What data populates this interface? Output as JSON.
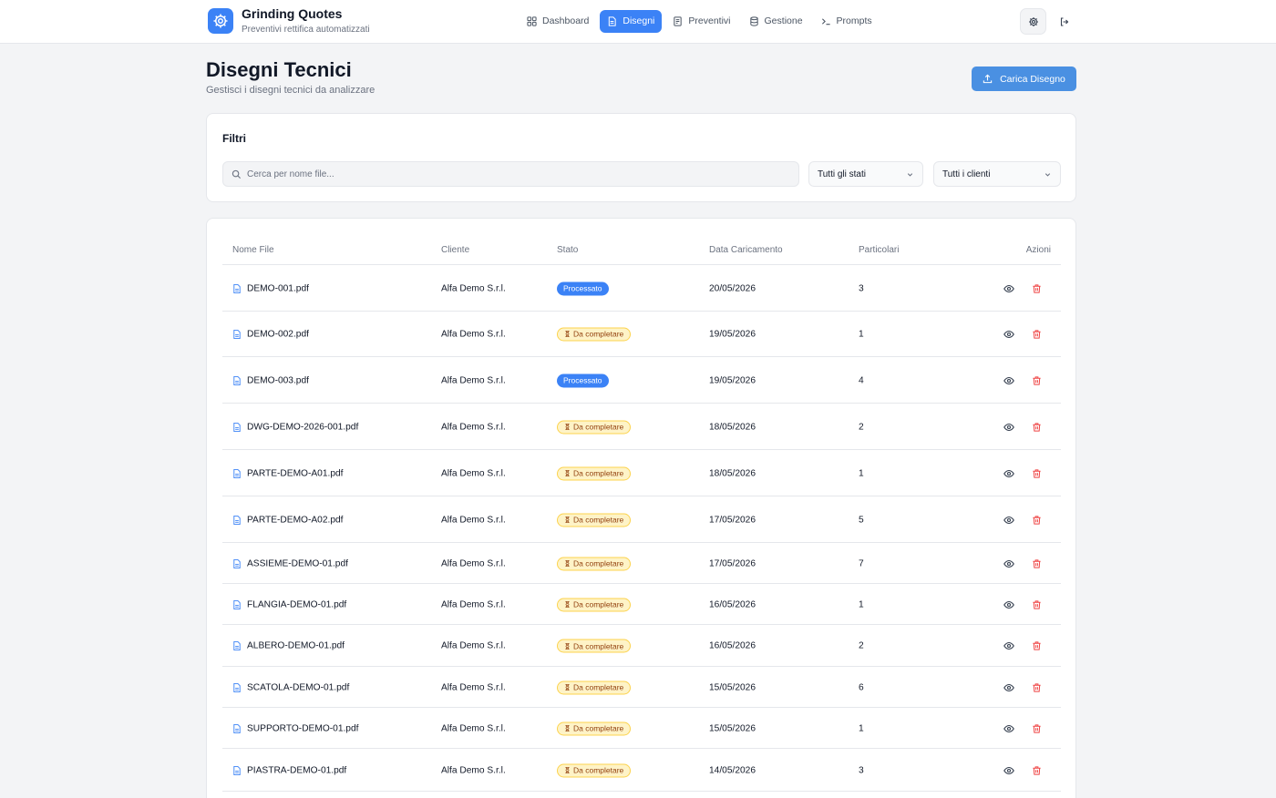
{
  "app": {
    "title": "Grinding Quotes",
    "subtitle": "Preventivi rettifica automatizzati",
    "accent": "#3b82f6"
  },
  "nav": [
    {
      "label": "Dashboard",
      "icon": "grid-icon",
      "active": false
    },
    {
      "label": "Disegni",
      "icon": "file-icon",
      "active": true
    },
    {
      "label": "Preventivi",
      "icon": "document-icon",
      "active": false
    },
    {
      "label": "Gestione",
      "icon": "database-icon",
      "active": false
    },
    {
      "label": "Prompts",
      "icon": "terminal-icon",
      "active": false
    }
  ],
  "page": {
    "title": "Disegni Tecnici",
    "subtitle": "Gestisci i disegni tecnici da analizzare",
    "upload_label": "Carica Disegno"
  },
  "filters": {
    "title": "Filtri",
    "search_placeholder": "Cerca per nome file...",
    "status_select": "Tutti gli stati",
    "client_select": "Tutti i clienti"
  },
  "table": {
    "headers": {
      "file": "Nome File",
      "client": "Cliente",
      "status": "Stato",
      "date": "Data Caricamento",
      "parts": "Particolari",
      "actions": "Azioni"
    },
    "rows": [
      {
        "file": "DEMO-001.pdf",
        "client": "Alfa Demo S.r.l.",
        "status": "Processato",
        "status_type": "processed",
        "date": "20/05/2026",
        "parts": "3"
      },
      {
        "file": "DEMO-002.pdf",
        "client": "Alfa Demo S.r.l.",
        "status": "Da completare",
        "status_type": "pending",
        "date": "19/05/2026",
        "parts": "1"
      },
      {
        "file": "DEMO-003.pdf",
        "client": "Alfa Demo S.r.l.",
        "status": "Processato",
        "status_type": "processed",
        "date": "19/05/2026",
        "parts": "4"
      },
      {
        "file": "DWG-DEMO-2026-001.pdf",
        "client": "Alfa Demo S.r.l.",
        "status": "Da completare",
        "status_type": "pending",
        "date": "18/05/2026",
        "parts": "2"
      },
      {
        "file": "PARTE-DEMO-A01.pdf",
        "client": "Alfa Demo S.r.l.",
        "status": "Da completare",
        "status_type": "pending",
        "date": "18/05/2026",
        "parts": "1"
      },
      {
        "file": "PARTE-DEMO-A02.pdf",
        "client": "Alfa Demo S.r.l.",
        "status": "Da completare",
        "status_type": "pending",
        "date": "17/05/2026",
        "parts": "5"
      },
      {
        "file": "ASSIEME-DEMO-01.pdf",
        "client": "Alfa Demo S.r.l.",
        "status": "Da completare",
        "status_type": "pending",
        "date": "17/05/2026",
        "parts": "7"
      },
      {
        "file": "FLANGIA-DEMO-01.pdf",
        "client": "Alfa Demo S.r.l.",
        "status": "Da completare",
        "status_type": "pending",
        "date": "16/05/2026",
        "parts": "1"
      },
      {
        "file": "ALBERO-DEMO-01.pdf",
        "client": "Alfa Demo S.r.l.",
        "status": "Da completare",
        "status_type": "pending",
        "date": "16/05/2026",
        "parts": "2"
      },
      {
        "file": "SCATOLA-DEMO-01.pdf",
        "client": "Alfa Demo S.r.l.",
        "status": "Da completare",
        "status_type": "pending",
        "date": "15/05/2026",
        "parts": "6"
      },
      {
        "file": "SUPPORTO-DEMO-01.pdf",
        "client": "Alfa Demo S.r.l.",
        "status": "Da completare",
        "status_type": "pending",
        "date": "15/05/2026",
        "parts": "1"
      },
      {
        "file": "PIASTRA-DEMO-01.pdf",
        "client": "Alfa Demo S.r.l.",
        "status": "Da completare",
        "status_type": "pending",
        "date": "14/05/2026",
        "parts": "3"
      }
    ]
  }
}
